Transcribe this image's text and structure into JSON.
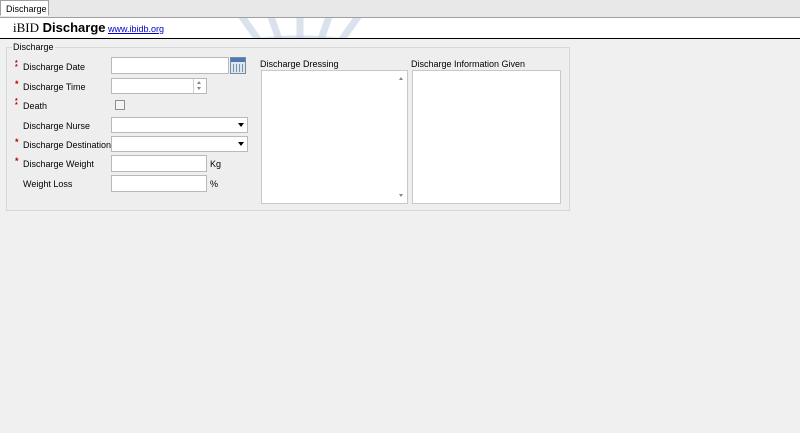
{
  "tabs": [
    {
      "label": "Discharge"
    }
  ],
  "header": {
    "brand_prefix": "iBID",
    "brand_title": "Discharge",
    "link_text": "www.ibidb.org"
  },
  "group": {
    "title": "Discharge",
    "fields": {
      "discharge_date": {
        "label": "Discharge Date",
        "value": ""
      },
      "discharge_time": {
        "label": "Discharge Time",
        "value": ""
      },
      "death": {
        "label": "Death",
        "checked": false
      },
      "discharge_nurse": {
        "label": "Discharge Nurse",
        "value": ""
      },
      "discharge_destination": {
        "label": "Discharge Destination",
        "value": ""
      },
      "discharge_weight": {
        "label": "Discharge Weight",
        "value": "",
        "unit": "Kg"
      },
      "weight_loss": {
        "label": "Weight Loss",
        "value": "",
        "unit": "%"
      }
    },
    "panels": {
      "dressing": {
        "label": "Discharge Dressing",
        "value": ""
      },
      "info_given": {
        "label": "Discharge Information Given",
        "value": ""
      }
    }
  },
  "colors": {
    "required_marker": "#c00000",
    "link": "#0000cc"
  },
  "icons": [
    "calendar-icon",
    "spin-up-icon",
    "spin-down-icon",
    "dropdown-arrow-icon",
    "scroll-up-icon",
    "scroll-down-icon"
  ]
}
